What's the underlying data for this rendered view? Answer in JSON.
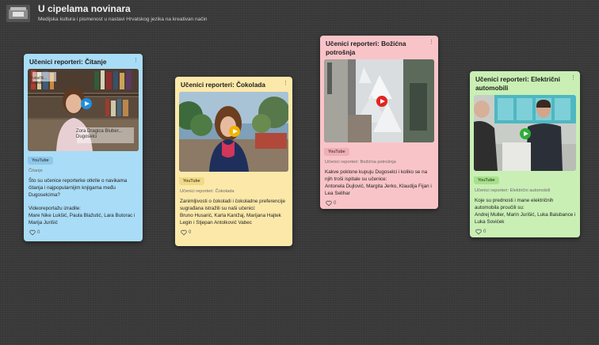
{
  "app": {
    "title": "U cipelama novinara",
    "subtitle": "Medijska kultura i pismenost u nastavi Hrvatskog jezika na kreativan način"
  },
  "colors": {
    "card_blue": "#a9dcf6",
    "card_yellow": "#fce9a9",
    "card_pink": "#f9c4c8",
    "card_green": "#c9efb4",
    "play_blue": "#1f8fe0",
    "play_yellow": "#f0b400",
    "play_red": "#e3231f",
    "play_green": "#2fae3a"
  },
  "cards": [
    {
      "title": "Učenici reporteri: Čitanje",
      "badge": "YouTube",
      "source": "Čitanje",
      "thumb_caption_top": "Sveučili... Zagreb",
      "thumb_caption_bottom": "Zora Dragica Bluber... Dugoselci",
      "description": "Što su učenice reporterke otkrile o navikama čitanja i najpopularnijim knjigama među Dugoselcima?",
      "credits": "Videoreportažu izradile:\n Mare Nike Lukšić, Paula Blažutić, Lara Butorac i Marija Jurišić",
      "likes": "0"
    },
    {
      "title": "Učenici reporteri: Čokolada",
      "badge": "YouTube",
      "source": "Učenici reporteri: Čokolada",
      "description": "Zanimljivosti o čokoladi i čokoladne preferencije sugrađana istražili su naši učenici:\nBruno Husarić, Karla Kanižaj, Marijana Hajtek Legin i Stjepan Antolković Vabec",
      "likes": "0"
    },
    {
      "title": "Učenici reporteri: Božićna potrošnja",
      "badge": "YouTube",
      "source": "Učenici reporteri: Božićna potrošnja",
      "description": "Kakve poklone kupuju Dugoselci i koliko se na njih troši ispitale su učenice:\nAntonela Dujlović, Margita Jerko, Klaudija Fijan i Lea Selihar",
      "likes": "0"
    },
    {
      "title": "Učenici reporteri: Električni automobili",
      "badge": "YouTube",
      "source": "Učenici reporteri: Električni automobili",
      "description": "Koje su prednosti i mane električnih automobila proučili su:\n Andrej Muller, Marin Jurišić, Luka Balubance i Luka Sovićek",
      "likes": "0"
    }
  ]
}
